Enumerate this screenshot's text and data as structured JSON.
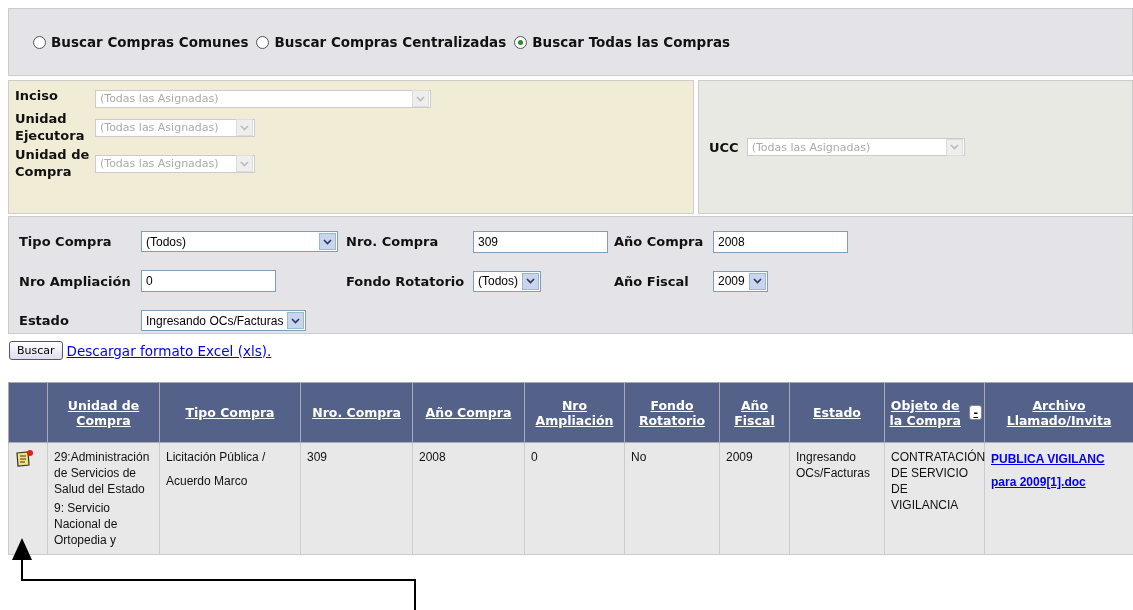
{
  "search_mode": {
    "options": [
      {
        "label": "Buscar Compras Comunes",
        "selected": false
      },
      {
        "label": "Buscar Compras Centralizadas",
        "selected": false
      },
      {
        "label": "Buscar Todas las Compras",
        "selected": true
      }
    ]
  },
  "org_filters": {
    "fields": [
      {
        "label": "Inciso",
        "value": "(Todas las Asignadas)",
        "disabled": true
      },
      {
        "label": "Unidad Ejecutora",
        "value": "(Todas las Asignadas)",
        "disabled": true
      },
      {
        "label": "Unidad de Compra",
        "value": "(Todas las Asignadas)",
        "disabled": true
      }
    ],
    "ucc": {
      "label": "UCC",
      "value": "(Todas las Asignadas)",
      "disabled": true
    }
  },
  "filters": [
    {
      "label": "Tipo Compra",
      "kind": "select",
      "value": "(Todos)"
    },
    {
      "label": "Nro. Compra",
      "kind": "text",
      "value": "309"
    },
    {
      "label": "Año Compra",
      "kind": "text",
      "value": "2008"
    },
    {
      "label": "Nro Ampliación",
      "kind": "text",
      "value": "0"
    },
    {
      "label": "Fondo Rotatorio",
      "kind": "select",
      "value": "(Todos)"
    },
    {
      "label": "Año Fiscal",
      "kind": "select",
      "value": "2009"
    },
    {
      "label": "Estado",
      "kind": "select",
      "value": "Ingresando OCs/Facturas"
    }
  ],
  "actions": {
    "button": "Buscar",
    "link": "Descargar formato Excel (xls)."
  },
  "table": {
    "columns": [
      {},
      {
        "label": "Unidad de Compra"
      },
      {
        "label": "Tipo Compra"
      },
      {
        "label": "Nro. Compra"
      },
      {
        "label": "Año Compra"
      },
      {
        "label": "Nro Ampliación"
      },
      {
        "label": "Fondo Rotatorio"
      },
      {
        "label": "Año Fiscal"
      },
      {
        "label": "Estado"
      },
      {
        "label": "Objeto de la Compra",
        "toggle": "-"
      },
      {
        "label": "Archivo Llamado/Invita"
      }
    ],
    "rows": [
      {
        "cells": [
          {
            "kind": "icon"
          },
          {
            "kind": "lines",
            "lines": [
              "29:Administración de Servicios de Salud del Estado",
              "9: Servicio Nacional de Ortopedia y"
            ]
          },
          {
            "kind": "lines",
            "lines": [
              "Licitación Pública /",
              "Acuerdo Marco"
            ]
          },
          {
            "kind": "text",
            "text": "309"
          },
          {
            "kind": "text",
            "text": "2008"
          },
          {
            "kind": "text",
            "text": "0"
          },
          {
            "kind": "text",
            "text": "No"
          },
          {
            "kind": "text",
            "text": "2009"
          },
          {
            "kind": "text",
            "text": "Ingresando OCs/Facturas"
          },
          {
            "kind": "text",
            "text": "CONTRATACIÓN DE SERVICIO DE VIGILANCIA"
          },
          {
            "kind": "link",
            "lines": [
              "PUBLICA VIGILANC",
              "para 2009[1].doc"
            ]
          }
        ]
      }
    ]
  }
}
